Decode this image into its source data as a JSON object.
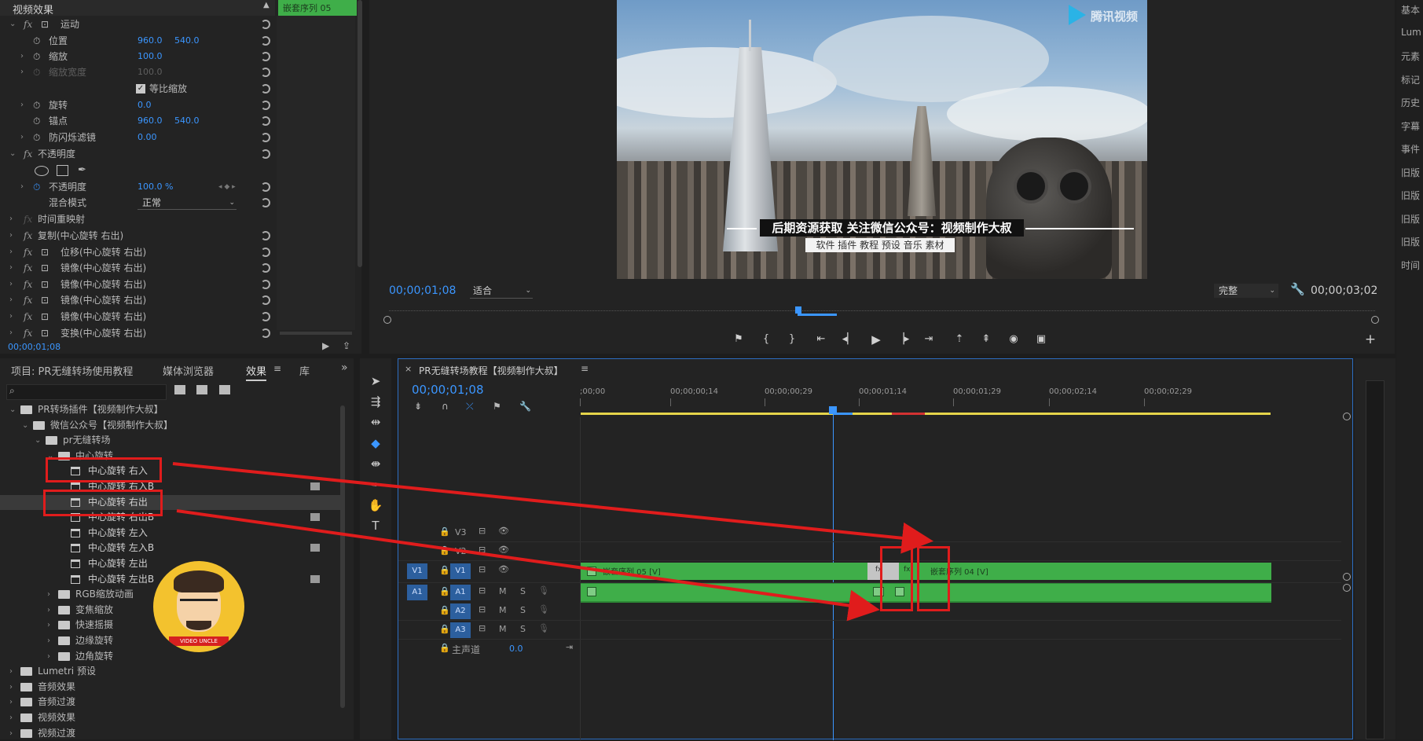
{
  "effect_controls": {
    "header": "视频效果",
    "clip_label": "嵌套序列 05",
    "motion": {
      "label": "运动"
    },
    "position": {
      "label": "位置",
      "x": "960.0",
      "y": "540.0"
    },
    "scale": {
      "label": "缩放",
      "value": "100.0"
    },
    "scale_width": {
      "label": "缩放宽度",
      "value": "100.0"
    },
    "uniform_scale": {
      "label": "等比缩放",
      "checked": true
    },
    "rotation": {
      "label": "旋转",
      "value": "0.0"
    },
    "anchor": {
      "label": "锚点",
      "x": "960.0",
      "y": "540.0"
    },
    "anti_flicker": {
      "label": "防闪烁滤镜",
      "value": "0.00"
    },
    "opacity_group": {
      "label": "不透明度"
    },
    "opacity": {
      "label": "不透明度",
      "value": "100.0 %"
    },
    "blend_mode": {
      "label": "混合模式",
      "value": "正常"
    },
    "time_remap": {
      "label": "时间重映射"
    },
    "extra_effects": [
      "复制(中心旋转 右出)",
      "位移(中心旋转 右出)",
      "镜像(中心旋转 右出)",
      "镜像(中心旋转 右出)",
      "镜像(中心旋转 右出)",
      "镜像(中心旋转 右出)",
      "变换(中心旋转 右出)"
    ],
    "timecode": "00;00;01;08"
  },
  "program_monitor": {
    "timecode": "00;00;01;08",
    "fit": "适合",
    "quality": "完整",
    "duration": "00;00;03;02",
    "overlay_title": "后期资源获取 关注微信公众号：视频制作大叔",
    "overlay_subtitle": "软件 插件 教程 预设 音乐 素材",
    "watermark": "腾讯视频"
  },
  "right_panel": {
    "items": [
      "基本",
      "Lum",
      "元素",
      "标记",
      "历史",
      "字幕",
      "事件",
      "旧版",
      "旧版",
      "旧版",
      "旧版",
      "时间"
    ]
  },
  "project_panel": {
    "tabs": [
      "项目: PR无缝转场使用教程",
      "媒体浏览器",
      "效果",
      "库"
    ],
    "active_tab": "效果",
    "tree": [
      {
        "label": "PR转场插件【视频制作大叔】",
        "level": 0,
        "type": "folder"
      },
      {
        "label": "微信公众号【视频制作大叔】",
        "level": 1,
        "type": "folder"
      },
      {
        "label": "pr无缝转场",
        "level": 2,
        "type": "folder"
      },
      {
        "label": "中心旋转",
        "level": 3,
        "type": "folder"
      },
      {
        "label": "中心旋转 右入",
        "level": 4,
        "type": "preset"
      },
      {
        "label": "中心旋转 右入B",
        "level": 4,
        "type": "preset"
      },
      {
        "label": "中心旋转 右出",
        "level": 4,
        "type": "preset"
      },
      {
        "label": "中心旋转 右出B",
        "level": 4,
        "type": "preset"
      },
      {
        "label": "中心旋转 左入",
        "level": 4,
        "type": "preset"
      },
      {
        "label": "中心旋转 左入B",
        "level": 4,
        "type": "preset"
      },
      {
        "label": "中心旋转 左出",
        "level": 4,
        "type": "preset"
      },
      {
        "label": "中心旋转 左出B",
        "level": 4,
        "type": "preset"
      },
      {
        "label": "RGB缩放动画",
        "level": 3,
        "type": "folder"
      },
      {
        "label": "变焦缩放",
        "level": 3,
        "type": "folder"
      },
      {
        "label": "快速摇摄",
        "level": 3,
        "type": "folder"
      },
      {
        "label": "边缘旋转",
        "level": 3,
        "type": "folder"
      },
      {
        "label": "边角旋转",
        "level": 3,
        "type": "folder"
      },
      {
        "label": "Lumetri 预设",
        "level": 0,
        "type": "folder"
      },
      {
        "label": "音频效果",
        "level": 0,
        "type": "folder"
      },
      {
        "label": "音频过渡",
        "level": 0,
        "type": "folder"
      },
      {
        "label": "视频效果",
        "level": 0,
        "type": "folder"
      },
      {
        "label": "视频过渡",
        "level": 0,
        "type": "folder"
      }
    ],
    "avatar_text": "VIDEO UNCLE"
  },
  "timeline": {
    "title": "PR无缝转场教程【视频制作大叔】",
    "timecode": "00;00;01;08",
    "ruler": [
      ";00;00",
      "00;00;00;14",
      "00;00;00;29",
      "00;00;01;14",
      "00;00;01;29",
      "00;00;02;14",
      "00;00;02;29"
    ],
    "tracks": {
      "v3": "V3",
      "v2": "V2",
      "v1": "V1",
      "v1_src": "V1",
      "a1": "A1",
      "a1_src": "A1",
      "a2": "A2",
      "a3": "A3",
      "master": "主声道",
      "master_value": "0.0"
    },
    "clip_v1_left": "嵌套序列 05 [V]",
    "clip_v1_right": "嵌套序列 04 [V]",
    "track_letters": {
      "m": "M",
      "s": "S"
    }
  },
  "colors": {
    "accent_blue": "#3b96ff",
    "clip_green": "#3fae49",
    "highlight_red": "#e01c1c"
  }
}
